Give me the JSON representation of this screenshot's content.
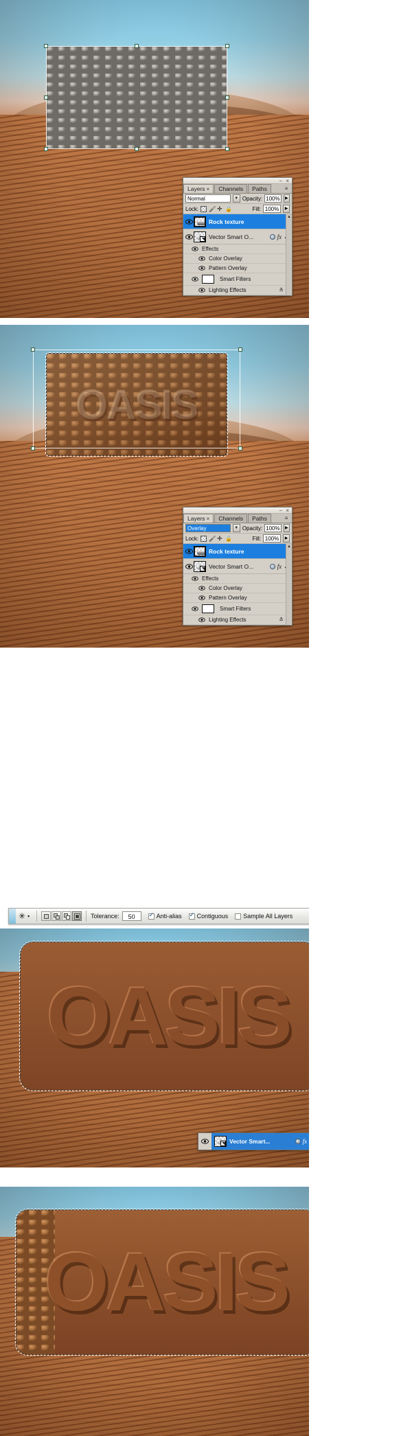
{
  "app": "Adobe Photoshop",
  "panel": {
    "tabs": [
      {
        "label": "Layers",
        "close": "×",
        "active": true
      },
      {
        "label": "Channels",
        "active": false
      },
      {
        "label": "Paths",
        "active": false
      }
    ],
    "menu_icon": "≡",
    "minimize_icon": "−",
    "close_icon": "×",
    "blend_label": "Normal",
    "blend_label_overlay": "Overlay",
    "opacity_label": "Opacity:",
    "opacity_value": "100%",
    "lock_label": "Lock:",
    "fill_label": "Fill:",
    "fill_value": "100%",
    "lock_icons": [
      "lock-transparency-icon",
      "lock-image-icon",
      "lock-position-icon",
      "lock-all-icon"
    ],
    "layers": [
      {
        "name": "Rock texture",
        "selected": true,
        "visible": true
      },
      {
        "name": "Vector Smart O...",
        "selected": false,
        "visible": true,
        "has_fx": true,
        "has_smart": true
      }
    ],
    "sub_items": [
      {
        "label": "Effects",
        "indent": 1
      },
      {
        "label": "Color Overlay",
        "indent": 2
      },
      {
        "label": "Pattern Overlay",
        "indent": 2
      },
      {
        "label": "Smart Filters",
        "indent": 1,
        "swatch": true
      },
      {
        "label": "Lighting Effects",
        "indent": 2
      }
    ]
  },
  "mini_layer": {
    "name": "Vector Smart...",
    "fx_label": "fx",
    "eye_icon": "eye-icon"
  },
  "options_bar": {
    "tool_icon": "magic-wand-icon",
    "preset_caret": "▾",
    "selection_modes": [
      {
        "name": "new-selection",
        "active": false
      },
      {
        "name": "add-to-selection",
        "active": false
      },
      {
        "name": "subtract-from-selection",
        "active": false
      },
      {
        "name": "intersect-with-selection",
        "active": true
      }
    ],
    "tolerance_label": "Tolerance:",
    "tolerance_value": "50",
    "anti_alias_label": "Anti-alias",
    "anti_alias_checked": true,
    "contiguous_label": "Contiguous",
    "contiguous_checked": true,
    "sample_all_layers_label": "Sample All Layers",
    "sample_all_layers_checked": false
  },
  "canvas": {
    "artwork_text": "OASIS",
    "rock_texture_label": "rock-texture-image",
    "desert_label": "desert-background-image"
  },
  "colors": {
    "selection_blue": "#1c7fe0",
    "panel_gray": "#d4d0c8",
    "sand": "#b4703f",
    "sky": "#7fc4e0",
    "rock_gray": "#9a968f",
    "rock_warm": "#a9713f"
  }
}
